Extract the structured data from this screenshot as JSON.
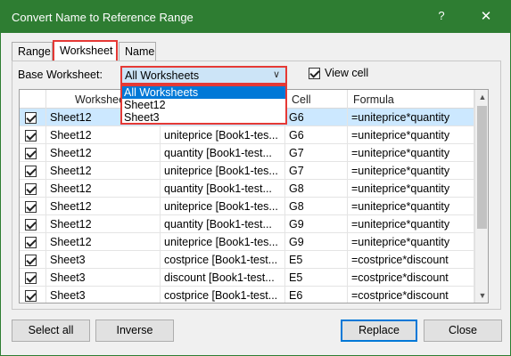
{
  "window": {
    "title": "Convert Name to Reference Range",
    "help": "?",
    "close": "✕"
  },
  "tabs": [
    {
      "label": "Range"
    },
    {
      "label": "Worksheet"
    },
    {
      "label": "Name"
    }
  ],
  "base_worksheet": {
    "label": "Base Worksheet:",
    "selected": "All Worksheets",
    "options": [
      "All Worksheets",
      "Sheet12",
      "Sheet3"
    ]
  },
  "view_cell": {
    "label": "View cell",
    "checked": true
  },
  "grid": {
    "columns": [
      "",
      "Worksheet",
      "",
      "Cell",
      "Formula"
    ],
    "rows": [
      {
        "worksheet": "Sheet12",
        "name": "",
        "cell": "G6",
        "formula": "=uniteprice*quantity"
      },
      {
        "worksheet": "Sheet12",
        "name": "uniteprice [Book1-tes...",
        "cell": "G6",
        "formula": "=uniteprice*quantity"
      },
      {
        "worksheet": "Sheet12",
        "name": "quantity [Book1-test...",
        "cell": "G7",
        "formula": "=uniteprice*quantity"
      },
      {
        "worksheet": "Sheet12",
        "name": "uniteprice [Book1-tes...",
        "cell": "G7",
        "formula": "=uniteprice*quantity"
      },
      {
        "worksheet": "Sheet12",
        "name": "quantity [Book1-test...",
        "cell": "G8",
        "formula": "=uniteprice*quantity"
      },
      {
        "worksheet": "Sheet12",
        "name": "uniteprice [Book1-tes...",
        "cell": "G8",
        "formula": "=uniteprice*quantity"
      },
      {
        "worksheet": "Sheet12",
        "name": "quantity [Book1-test...",
        "cell": "G9",
        "formula": "=uniteprice*quantity"
      },
      {
        "worksheet": "Sheet12",
        "name": "uniteprice [Book1-tes...",
        "cell": "G9",
        "formula": "=uniteprice*quantity"
      },
      {
        "worksheet": "Sheet3",
        "name": "costprice [Book1-test...",
        "cell": "E5",
        "formula": "=costprice*discount"
      },
      {
        "worksheet": "Sheet3",
        "name": "discount [Book1-test...",
        "cell": "E5",
        "formula": "=costprice*discount"
      },
      {
        "worksheet": "Sheet3",
        "name": "costprice [Book1-test...",
        "cell": "E6",
        "formula": "=costprice*discount"
      }
    ]
  },
  "buttons": {
    "select_all": "Select all",
    "inverse": "Inverse",
    "replace": "Replace",
    "close": "Close"
  },
  "colors": {
    "title_bar": "#2e7d32",
    "highlight_border": "#e53935",
    "selection": "#0078d7",
    "selected_row": "#cce8ff"
  }
}
